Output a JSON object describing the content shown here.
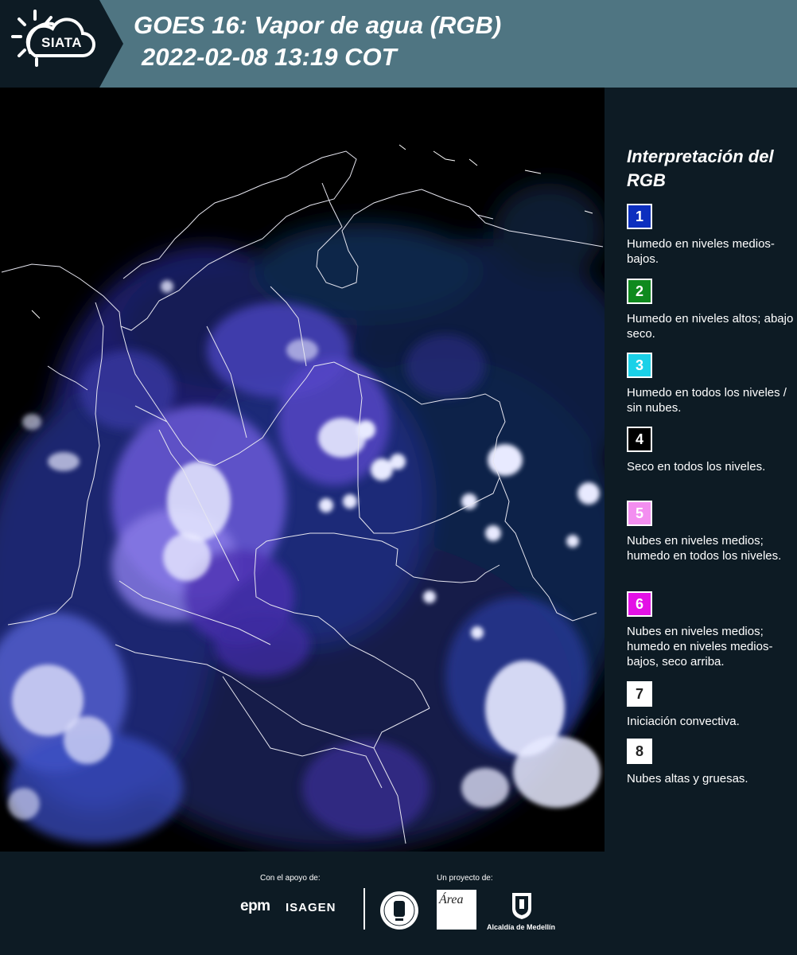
{
  "header": {
    "logo_text": "SIATA",
    "title_line1": "GOES 16: Vapor de agua (RGB)",
    "title_line2": "2022-02-08 13:19 COT",
    "colors": {
      "bar": "#4f7582",
      "logo_bg": "#0d1b24"
    }
  },
  "legend": {
    "title": "Interpretación del RGB",
    "items": [
      {
        "number": "1",
        "color": "#0c2fbf",
        "label": "Humedo en niveles medios-bajos."
      },
      {
        "number": "2",
        "color": "#0f8a1e",
        "label": "Humedo en niveles altos; abajo seco."
      },
      {
        "number": "3",
        "color": "#1ad1e8",
        "label": "Humedo en todos los niveles / sin nubes."
      },
      {
        "number": "4",
        "color": "#000000",
        "label": "Seco en todos los niveles."
      },
      {
        "number": "5",
        "color": "#f38ef0",
        "label": "Nubes en niveles medios; humedo en todos los niveles."
      },
      {
        "number": "6",
        "color": "#e311e6",
        "label": "Nubes en niveles medios; humedo en niveles medios-bajos, seco arriba."
      },
      {
        "number": "7",
        "color": "#ffffff",
        "label": "Iniciación convectiva."
      },
      {
        "number": "8",
        "color": "#ffffff",
        "label": "Nubes altas y gruesas."
      }
    ]
  },
  "footer": {
    "support_label": "Con el apoyo de:",
    "project_label": "Un proyecto de:",
    "sponsors": [
      "epm",
      "ISAGEN"
    ],
    "partners": [
      "Área Metropolitana",
      "Alcaldía de Medellín"
    ],
    "area_logo_text": "Área",
    "alcaldia_text": "Alcaldía de Medellín"
  }
}
